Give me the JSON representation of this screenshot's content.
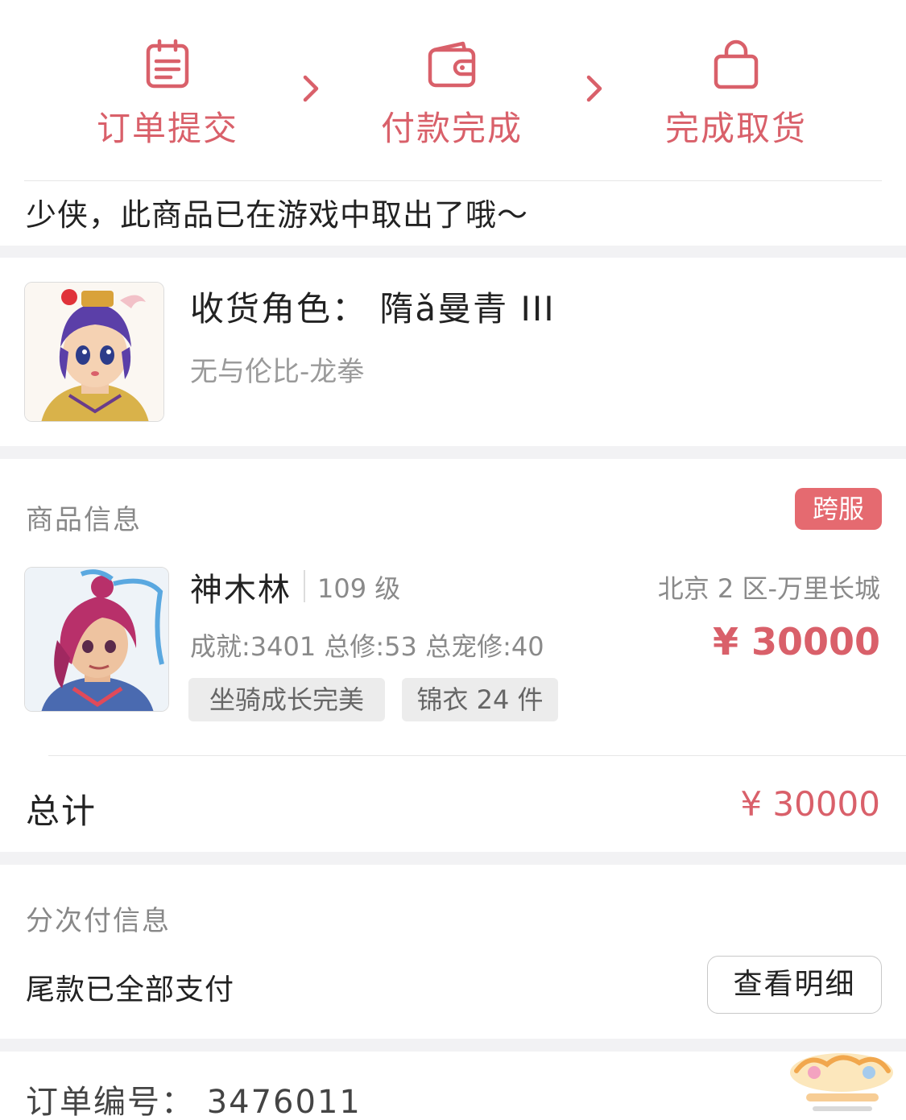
{
  "steps": [
    {
      "label": "订单提交",
      "icon": "clipboard-icon"
    },
    {
      "label": "付款完成",
      "icon": "wallet-icon"
    },
    {
      "label": "完成取货",
      "icon": "shopping-bag-icon"
    }
  ],
  "notice": "少侠，此商品已在游戏中取出了哦～",
  "role": {
    "name": "收货角色：  隋ǎ曼青 III",
    "server": "无与伦比-龙拳"
  },
  "goods": {
    "section_title": "商品信息",
    "badge": "跨服",
    "item_name": "神木林",
    "item_level": "109 级",
    "item_server": "北京 2 区-万里长城",
    "item_stats": "成就:3401 总修:53 总宠修:40",
    "item_price": "¥ 30000",
    "tags": [
      "坐骑成长完美",
      "锦衣 24 件"
    ],
    "total_label": "总计",
    "total_value": "¥ 30000"
  },
  "payment": {
    "section_title": "分次付信息",
    "status": "尾款已全部支付",
    "detail_button": "查看明细"
  },
  "order": {
    "number": "订单编号：  3476011"
  },
  "colors": {
    "accent": "#d9606a",
    "badge": "#e56a70",
    "separator": "#f2f2f4"
  }
}
